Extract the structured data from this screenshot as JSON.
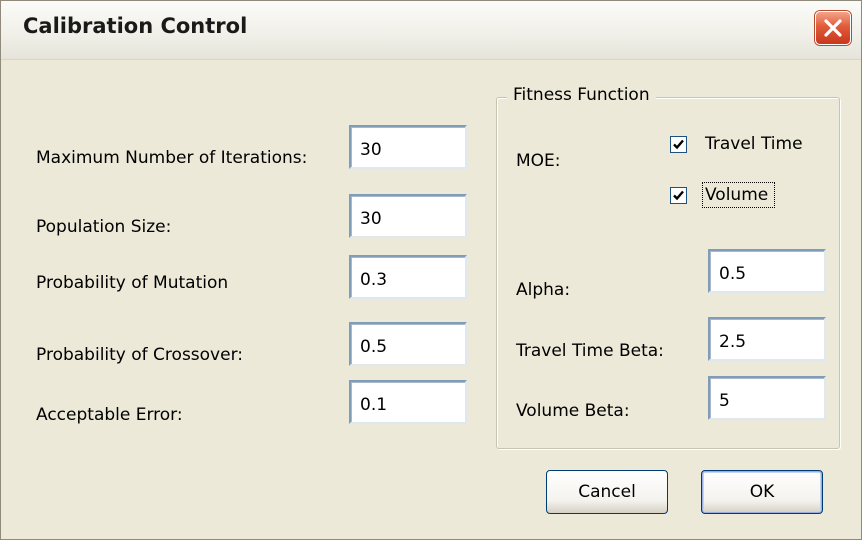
{
  "window": {
    "title": "Calibration Control"
  },
  "left_fields": {
    "max_iterations": {
      "label": "Maximum Number of Iterations:",
      "value": "30"
    },
    "population_size": {
      "label": "Population Size:",
      "value": "30"
    },
    "prob_mutation": {
      "label": "Probability of Mutation",
      "value": "0.3"
    },
    "prob_crossover": {
      "label": "Probability of Crossover:",
      "value": "0.5"
    },
    "acceptable_error": {
      "label": "Acceptable Error:",
      "value": "0.1"
    }
  },
  "fitness": {
    "group_label": "Fitness Function",
    "moe_label": "MOE:",
    "travel_time": {
      "label": "Travel Time",
      "checked": true
    },
    "volume": {
      "label": "Volume",
      "checked": true
    },
    "alpha": {
      "label": "Alpha:",
      "value": "0.5"
    },
    "travel_time_beta": {
      "label": "Travel Time Beta:",
      "value": "2.5"
    },
    "volume_beta": {
      "label": "Volume Beta:",
      "value": "5"
    }
  },
  "buttons": {
    "cancel": "Cancel",
    "ok": "OK"
  },
  "colors": {
    "dialog_bg": "#ece9d8",
    "close_button": "#e15b3a",
    "field_border": "#7f9db9",
    "button_border": "#003c74"
  },
  "icons": {
    "close": "close-x-icon",
    "check": "checkmark-icon"
  }
}
